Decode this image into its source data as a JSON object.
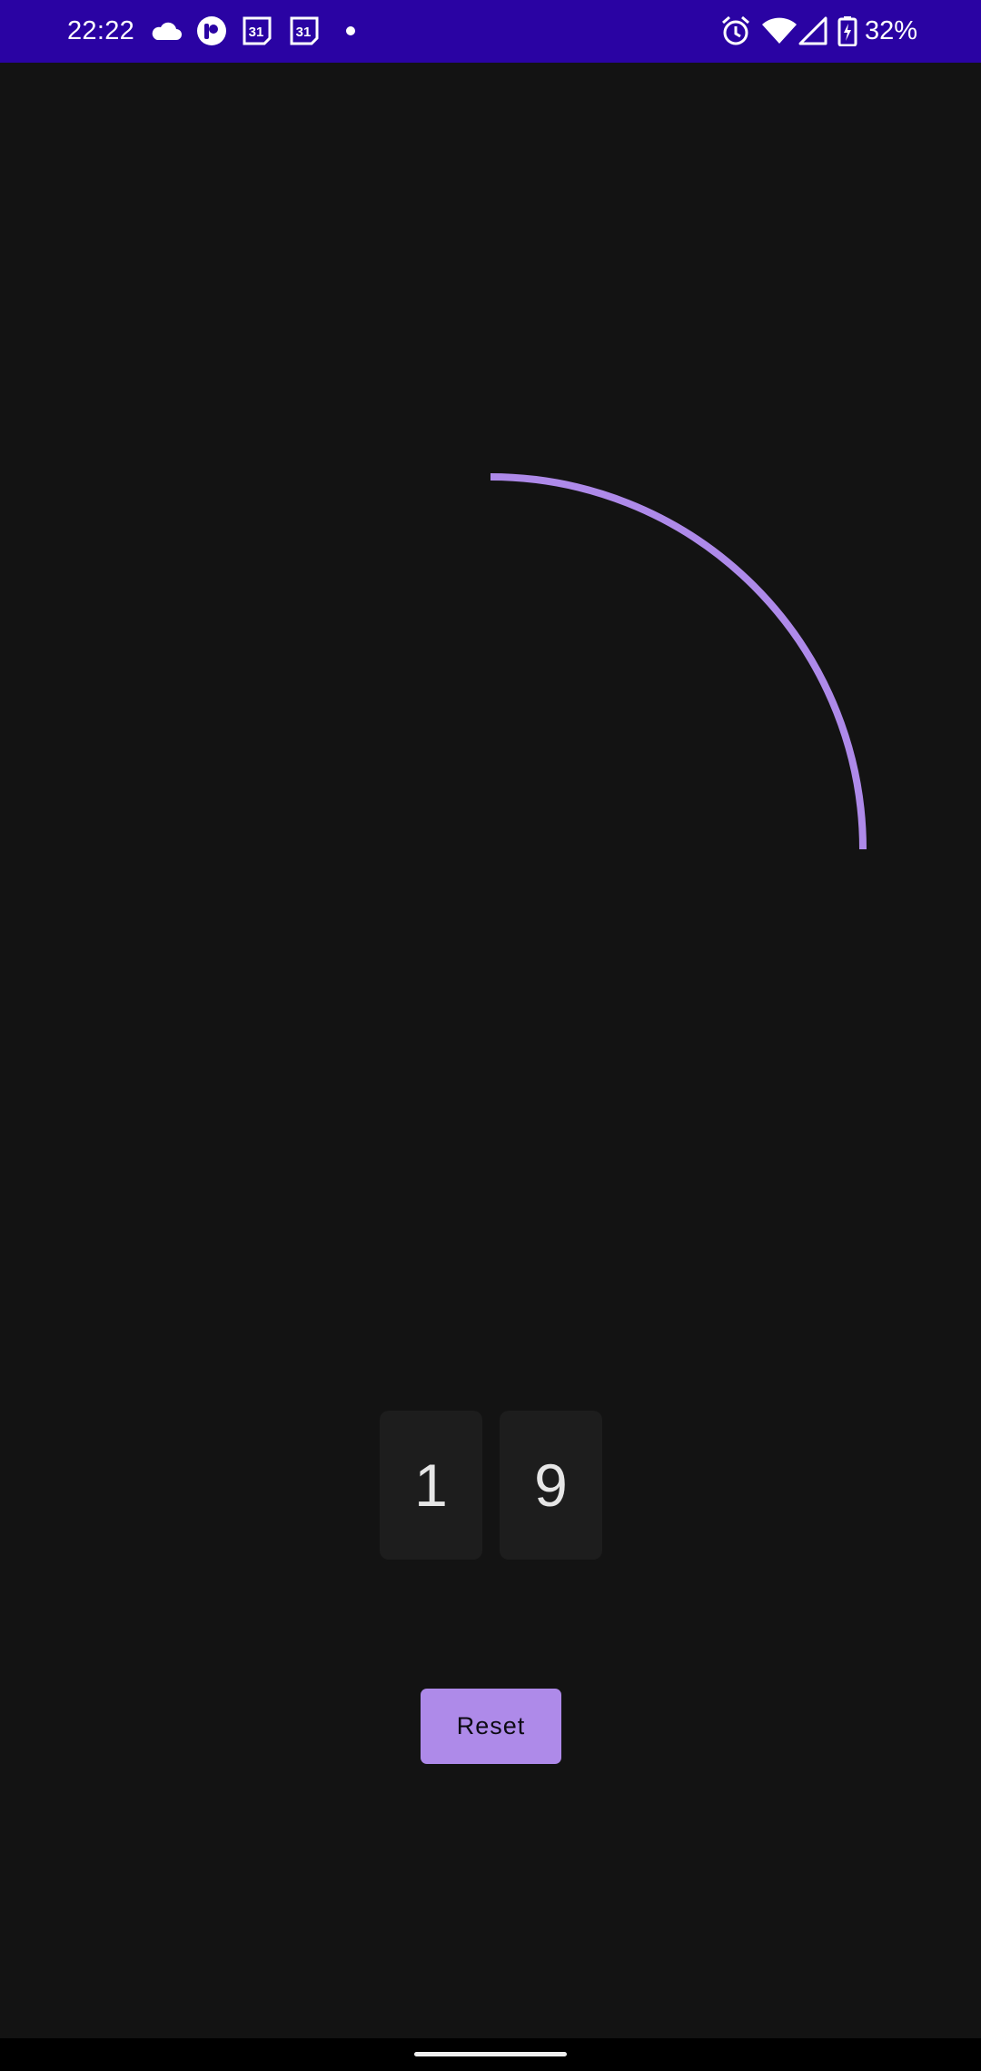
{
  "status_bar": {
    "time": "22:22",
    "battery": "32%",
    "calendar_day_1": "31",
    "calendar_day_2": "31",
    "icons": [
      "cloud-icon",
      "pocket-casts-icon",
      "calendar-icon",
      "calendar-icon",
      "dot-icon",
      "alarm-icon",
      "wifi-icon",
      "signal-icon",
      "battery-charging-icon"
    ],
    "background_color": "#2a03a3"
  },
  "timer": {
    "digits": [
      "1",
      "9"
    ],
    "progress_arc_color": "#ae8ae9",
    "progress_fraction": 0.25
  },
  "actions": {
    "reset_label": "Reset",
    "reset_color": "#ae8ae9"
  }
}
